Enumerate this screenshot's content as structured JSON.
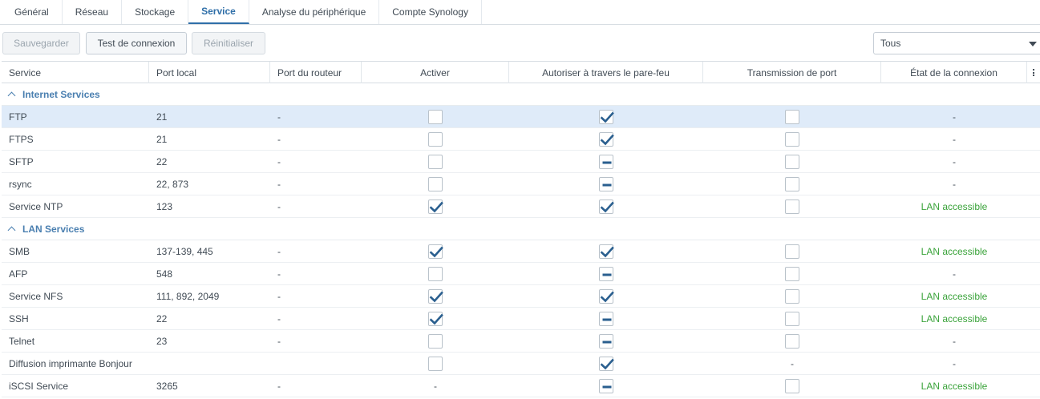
{
  "tabs": [
    {
      "label": "Général",
      "active": false
    },
    {
      "label": "Réseau",
      "active": false
    },
    {
      "label": "Stockage",
      "active": false
    },
    {
      "label": "Service",
      "active": true
    },
    {
      "label": "Analyse du périphérique",
      "active": false
    },
    {
      "label": "Compte Synology",
      "active": false
    }
  ],
  "toolbar": {
    "save_label": "Sauvegarder",
    "test_label": "Test de connexion",
    "reset_label": "Réinitialiser",
    "filter_value": "Tous"
  },
  "columns": {
    "service": "Service",
    "local_port": "Port local",
    "router_port": "Port du routeur",
    "enable": "Activer",
    "firewall": "Autoriser à travers le pare-feu",
    "forward": "Transmission de port",
    "status": "État de la connexion"
  },
  "groups": [
    {
      "label": "Internet Services",
      "rows": [
        {
          "service": "FTP",
          "local_port": "21",
          "router_port": "-",
          "enable": "unchecked",
          "firewall": "checked",
          "forward": "unchecked",
          "status": "-",
          "selected": true
        },
        {
          "service": "FTPS",
          "local_port": "21",
          "router_port": "-",
          "enable": "unchecked",
          "firewall": "checked",
          "forward": "unchecked",
          "status": "-"
        },
        {
          "service": "SFTP",
          "local_port": "22",
          "router_port": "-",
          "enable": "unchecked",
          "firewall": "partial",
          "forward": "unchecked",
          "status": "-"
        },
        {
          "service": "rsync",
          "local_port": "22, 873",
          "router_port": "-",
          "enable": "unchecked",
          "firewall": "partial",
          "forward": "unchecked",
          "status": "-"
        },
        {
          "service": "Service NTP",
          "local_port": "123",
          "router_port": "-",
          "enable": "checked",
          "firewall": "checked",
          "forward": "unchecked",
          "status": "LAN accessible"
        }
      ]
    },
    {
      "label": "LAN Services",
      "rows": [
        {
          "service": "SMB",
          "local_port": "137-139, 445",
          "router_port": "-",
          "enable": "checked",
          "firewall": "checked",
          "forward": "unchecked",
          "status": "LAN accessible"
        },
        {
          "service": "AFP",
          "local_port": "548",
          "router_port": "-",
          "enable": "unchecked",
          "firewall": "partial",
          "forward": "unchecked",
          "status": "-"
        },
        {
          "service": "Service NFS",
          "local_port": "111, 892, 2049",
          "router_port": "-",
          "enable": "checked",
          "firewall": "checked",
          "forward": "unchecked",
          "status": "LAN accessible"
        },
        {
          "service": "SSH",
          "local_port": "22",
          "router_port": "-",
          "enable": "checked",
          "firewall": "partial",
          "forward": "unchecked",
          "status": "LAN accessible"
        },
        {
          "service": "Telnet",
          "local_port": "23",
          "router_port": "-",
          "enable": "unchecked",
          "firewall": "partial",
          "forward": "unchecked",
          "status": "-"
        },
        {
          "service": "Diffusion imprimante Bonjour",
          "local_port": "",
          "router_port": "",
          "enable": "unchecked",
          "firewall": "checked",
          "forward": "-",
          "status": "-"
        },
        {
          "service": "iSCSI Service",
          "local_port": "3265",
          "router_port": "-",
          "enable": "-",
          "firewall": "partial",
          "forward": "unchecked",
          "status": "LAN accessible"
        }
      ]
    }
  ],
  "colors": {
    "accent": "#2f6fa8",
    "group": "#4a7fb0",
    "status_ok": "#3aa33a",
    "selected_row": "#dfebf9"
  },
  "icons": {
    "checked": "check-icon",
    "partial": "dash-icon",
    "group_toggle": "chevron-up-icon",
    "column_menu": "kebab-menu-icon",
    "dropdown": "caret-down-icon"
  }
}
